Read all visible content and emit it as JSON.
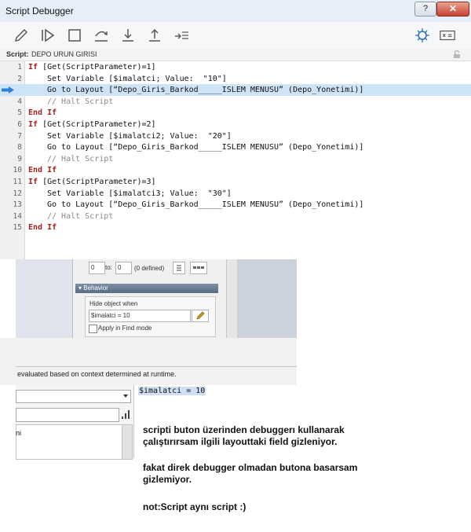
{
  "window": {
    "title": "Script Debugger",
    "help_label": "?",
    "close_label": "✕"
  },
  "script_bar": {
    "label": "Script:",
    "name": "DEPO URUN GIRISI"
  },
  "code_lines": [
    {
      "n": "1",
      "parts": [
        {
          "t": "If",
          "c": "kw"
        },
        {
          "t": " [Get(ScriptParameter)=1]",
          "c": ""
        }
      ],
      "indent": 0
    },
    {
      "n": "2",
      "parts": [
        {
          "t": "Set Variable [$imalatci; Value:  \"10\"]",
          "c": ""
        }
      ],
      "indent": 1
    },
    {
      "n": "",
      "parts": [
        {
          "t": "Go to Layout [“Depo_Giris_Barkod_____ISLEM MENUSU” (Depo_Yonetimi)]",
          "c": ""
        }
      ],
      "indent": 1,
      "current": true
    },
    {
      "n": "4",
      "parts": [
        {
          "t": "// Halt Script",
          "c": "cmt"
        }
      ],
      "indent": 1
    },
    {
      "n": "5",
      "parts": [
        {
          "t": "End If",
          "c": "kw"
        }
      ],
      "indent": 0
    },
    {
      "n": "6",
      "parts": [
        {
          "t": "If",
          "c": "kw"
        },
        {
          "t": " [Get(ScriptParameter)=2]",
          "c": ""
        }
      ],
      "indent": 0
    },
    {
      "n": "7",
      "parts": [
        {
          "t": "Set Variable [$imalatci2; Value:  \"20\"]",
          "c": ""
        }
      ],
      "indent": 1
    },
    {
      "n": "8",
      "parts": [
        {
          "t": "Go to Layout [“Depo_Giris_Barkod_____ISLEM MENUSU” (Depo_Yonetimi)]",
          "c": ""
        }
      ],
      "indent": 1
    },
    {
      "n": "9",
      "parts": [
        {
          "t": "// Halt Script",
          "c": "cmt"
        }
      ],
      "indent": 1
    },
    {
      "n": "10",
      "parts": [
        {
          "t": "End If",
          "c": "kw"
        }
      ],
      "indent": 0
    },
    {
      "n": "11",
      "parts": [
        {
          "t": "If",
          "c": "kw"
        },
        {
          "t": " [Get(ScriptParameter)=3]",
          "c": ""
        }
      ],
      "indent": 0
    },
    {
      "n": "12",
      "parts": [
        {
          "t": "Set Variable [$imalatci3; Value:  \"30\"]",
          "c": ""
        }
      ],
      "indent": 1
    },
    {
      "n": "13",
      "parts": [
        {
          "t": "Go to Layout [“Depo_Giris_Barkod_____ISLEM MENUSU” (Depo_Yonetimi)]",
          "c": ""
        }
      ],
      "indent": 1
    },
    {
      "n": "14",
      "parts": [
        {
          "t": "// Halt Script",
          "c": "cmt"
        }
      ],
      "indent": 1
    },
    {
      "n": "15",
      "parts": [
        {
          "t": "End If",
          "c": "kw"
        }
      ],
      "indent": 0
    }
  ],
  "inspector": {
    "from_value": "0",
    "to_label": "to:",
    "to_value": "0",
    "defined_text": "(0 defined)",
    "behavior_header": "Behavior",
    "hide_label": "Hide object when",
    "hide_value": "$imalatci = 10",
    "apply_find_label": "Apply in Find mode"
  },
  "runtime_text": "evaluated based on context determined at runtime.",
  "data_viewer": {
    "list_item": "ni",
    "value_text": "$imalatci = 10"
  },
  "notes": {
    "line1": "scripti buton üzerinden debuggerı kullanarak",
    "line2": "çalıştırırsam ilgili layouttaki field gizleniyor.",
    "line3": "fakat direk debugger olmadan butona basarsam",
    "line4": "gizlemiyor.",
    "line5": "not:Script aynı script :)"
  },
  "toolbar_icons": [
    "pencil-icon",
    "step-run-icon",
    "stop-icon",
    "step-over-icon",
    "step-into-icon",
    "step-out-icon",
    "set-next-step-icon",
    "breakpoint-icon",
    "data-viewer-icon"
  ]
}
